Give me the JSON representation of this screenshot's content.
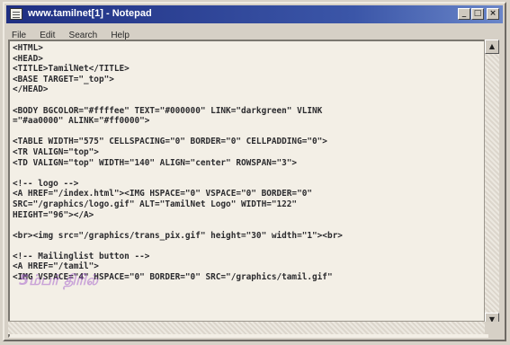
{
  "window": {
    "title": "www.tamilnet[1] - Notepad",
    "controls": {
      "minimize": "_",
      "maximize": "□",
      "close": "×"
    }
  },
  "menu": {
    "file": "File",
    "edit": "Edit",
    "search": "Search",
    "help": "Help"
  },
  "editor": {
    "lines": [
      "<HTML>",
      "<HEAD>",
      "<TITLE>TamilNet</TITLE>",
      "<BASE TARGET=\"_top\">",
      "</HEAD>",
      "",
      "<BODY BGCOLOR=\"#ffffee\" TEXT=\"#000000\" LINK=\"darkgreen\" VLINK",
      "=\"#aa0000\" ALINK=\"#ff0000\">",
      "",
      "<TABLE WIDTH=\"575\" CELLSPACING=\"0\" BORDER=\"0\" CELLPADDING=\"0\">",
      "<TR VALIGN=\"top\">",
      "<TD VALIGN=\"top\" WIDTH=\"140\" ALIGN=\"center\" ROWSPAN=\"3\">",
      "",
      "<!-- logo -->",
      "<A HREF=\"/index.html\"><IMG HSPACE=\"0\" VSPACE=\"0\" BORDER=\"0\"",
      "SRC=\"/graphics/logo.gif\" ALT=\"TamilNet Logo\" WIDTH=\"122\"",
      "HEIGHT=\"96\"></A>",
      "",
      "<br><img src=\"/graphics/trans_pix.gif\" height=\"30\" width=\"1\"><br>",
      "",
      "<!-- Mailinglist button -->",
      "<A HREF=\"/tamil\">",
      "<IMG VSPACE=\"4\" HSPACE=\"0\" BORDER=\"0\" SRC=\"/graphics/tamil.gif\""
    ]
  },
  "overlay": {
    "stamp_text": "5ம்பர் திரில்"
  },
  "scrollbar": {
    "up": "▲",
    "down": "▼"
  }
}
